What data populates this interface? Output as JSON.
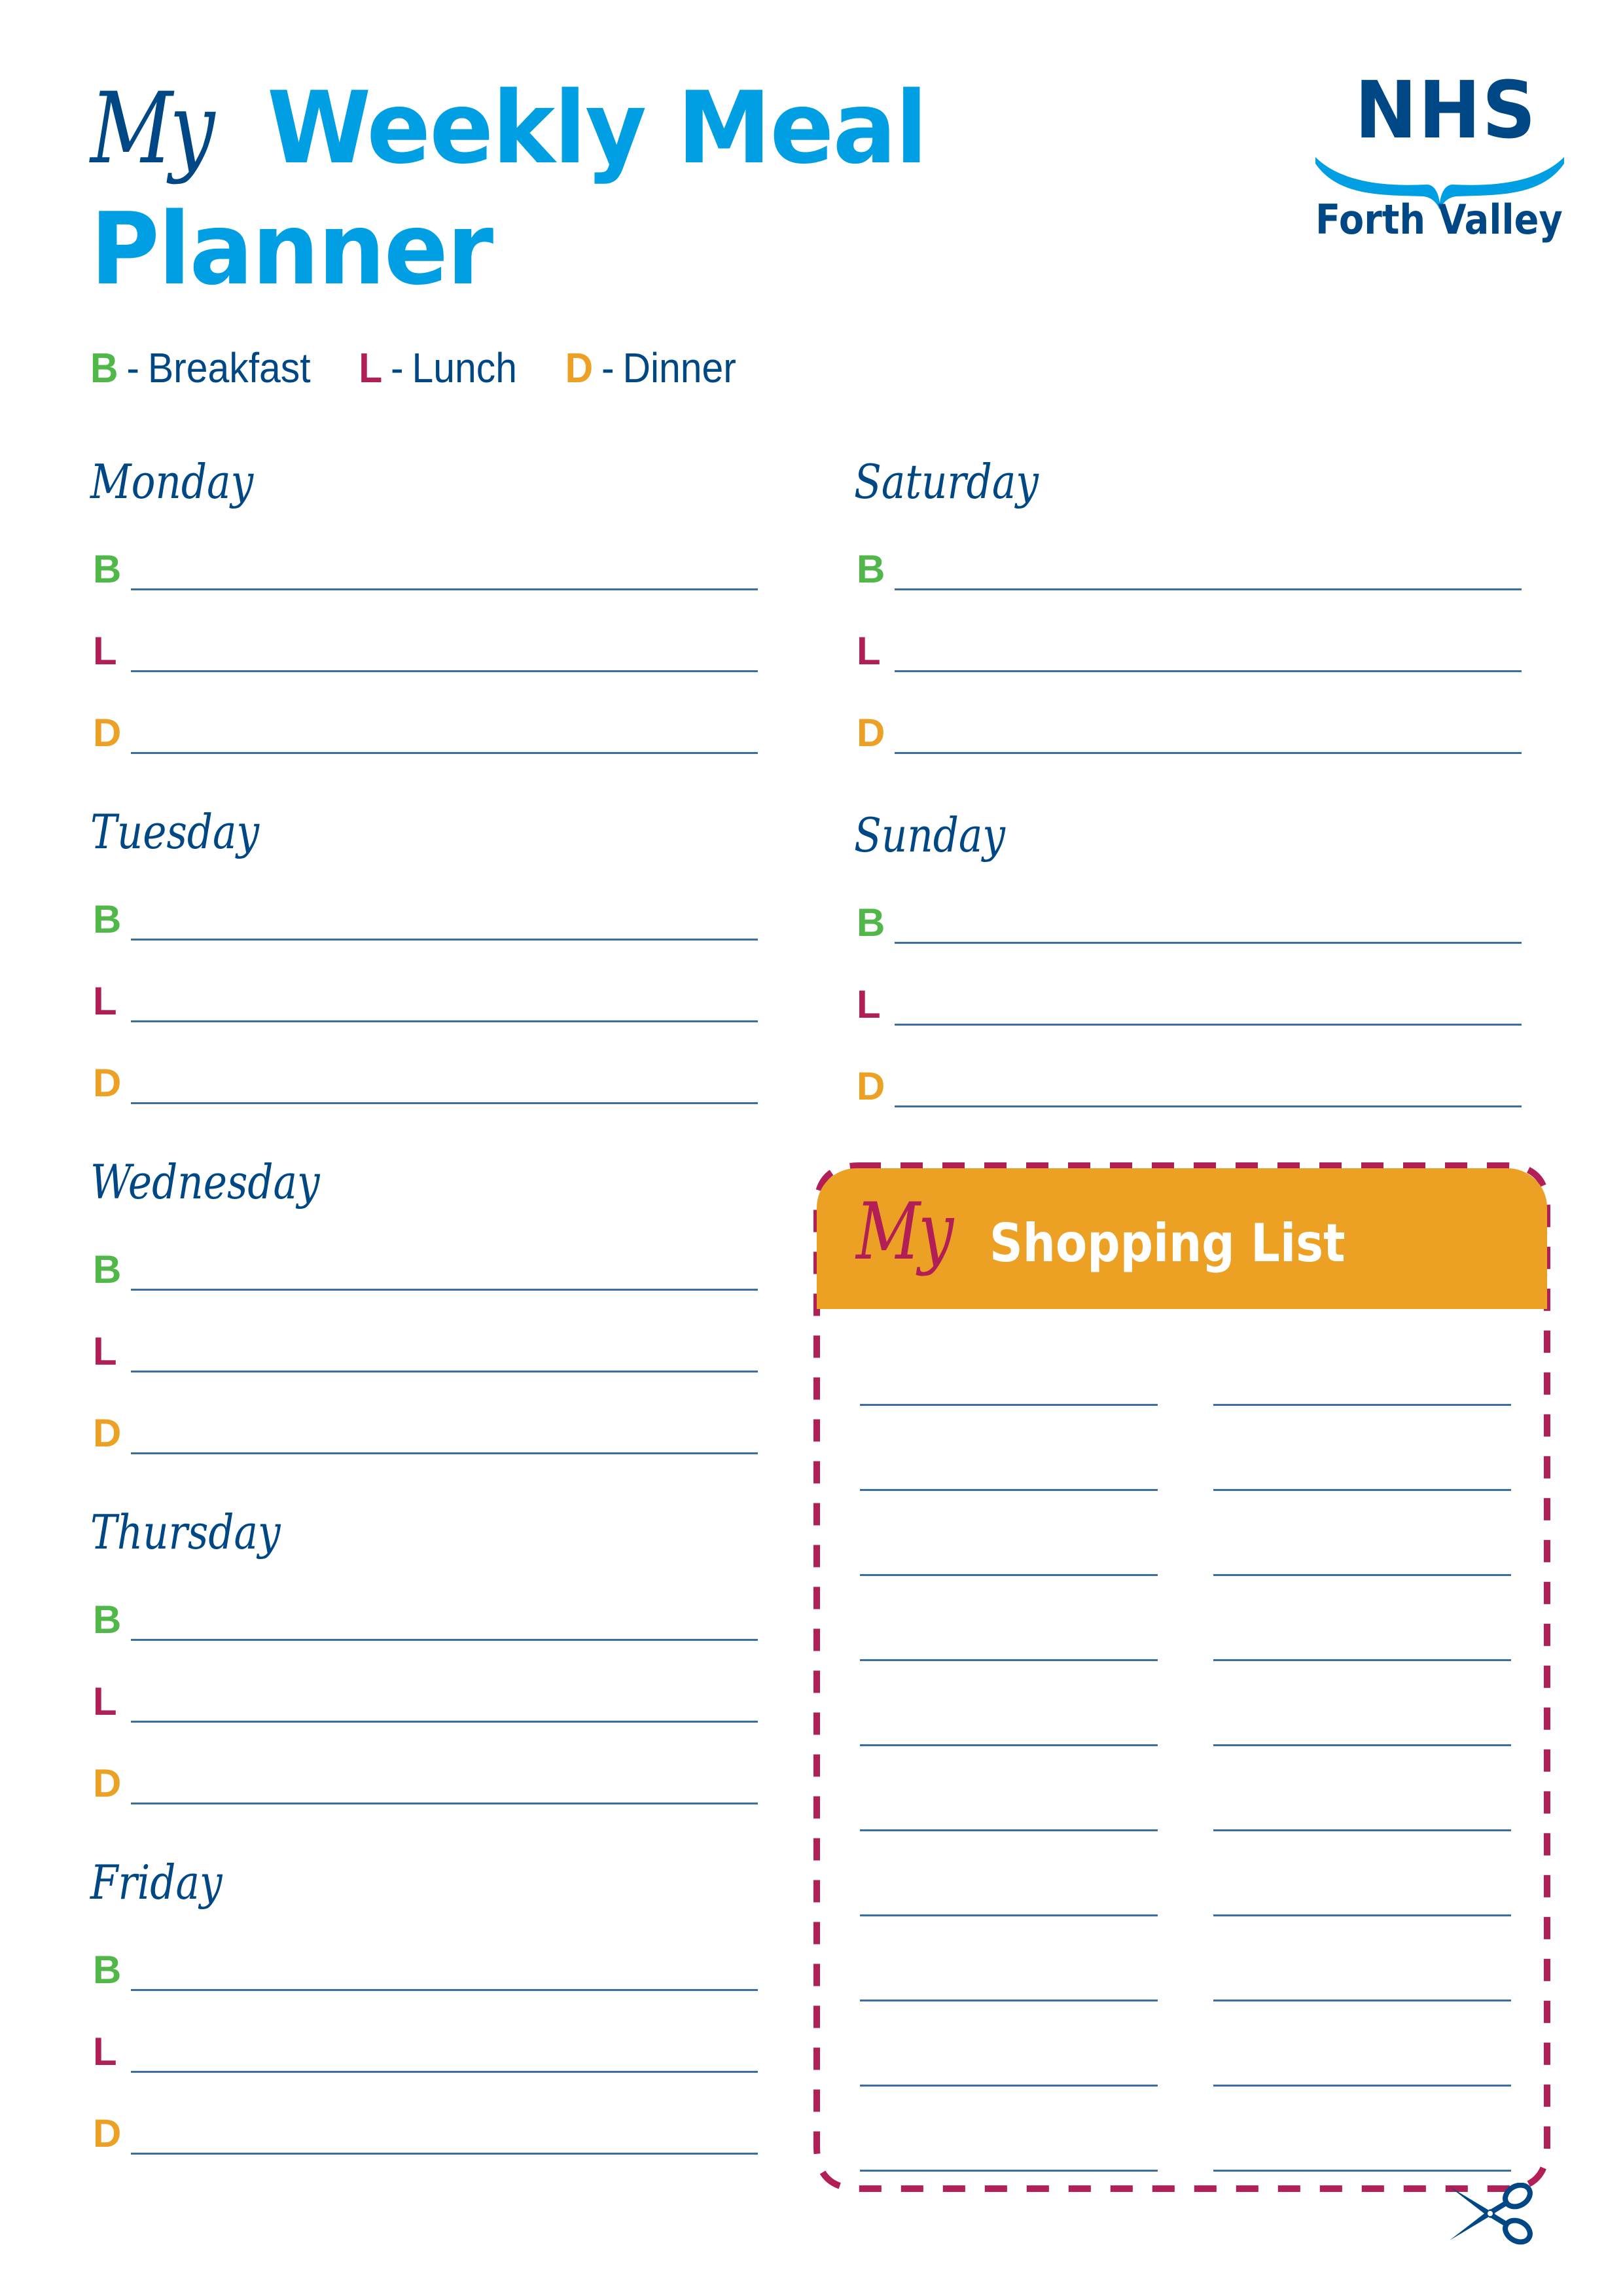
{
  "title": {
    "my": "My",
    "line1": "Weekly Meal",
    "line2": "Planner"
  },
  "logo": {
    "nhs": "NHS",
    "region": "Forth Valley"
  },
  "colors": {
    "navy": "#004785",
    "title_blue": "#009fe3",
    "breakfast": "#50b848",
    "lunch": "#b11f56",
    "dinner": "#eca024",
    "line": "#3b6ea3",
    "shopping_header": "#eca024",
    "dashed_border": "#b11f56"
  },
  "legend": [
    {
      "letter": "B",
      "separator": "-",
      "label": "Breakfast",
      "color": "#50b848"
    },
    {
      "letter": "L",
      "separator": "-",
      "label": "Lunch",
      "color": "#b11f56"
    },
    {
      "letter": "D",
      "separator": "-",
      "label": "Dinner",
      "color": "#eca024"
    }
  ],
  "days": [
    {
      "name": "Monday",
      "meals": [
        "B",
        "L",
        "D"
      ]
    },
    {
      "name": "Tuesday",
      "meals": [
        "B",
        "L",
        "D"
      ]
    },
    {
      "name": "Wednesday",
      "meals": [
        "B",
        "L",
        "D"
      ]
    },
    {
      "name": "Thursday",
      "meals": [
        "B",
        "L",
        "D"
      ]
    },
    {
      "name": "Friday",
      "meals": [
        "B",
        "L",
        "D"
      ]
    },
    {
      "name": "Saturday",
      "meals": [
        "B",
        "L",
        "D"
      ]
    },
    {
      "name": "Sunday",
      "meals": [
        "B",
        "L",
        "D"
      ]
    }
  ],
  "shopping_list": {
    "my": "My",
    "title": "Shopping List",
    "rows": 10,
    "columns": 2,
    "cut_icon": "scissors-icon"
  }
}
